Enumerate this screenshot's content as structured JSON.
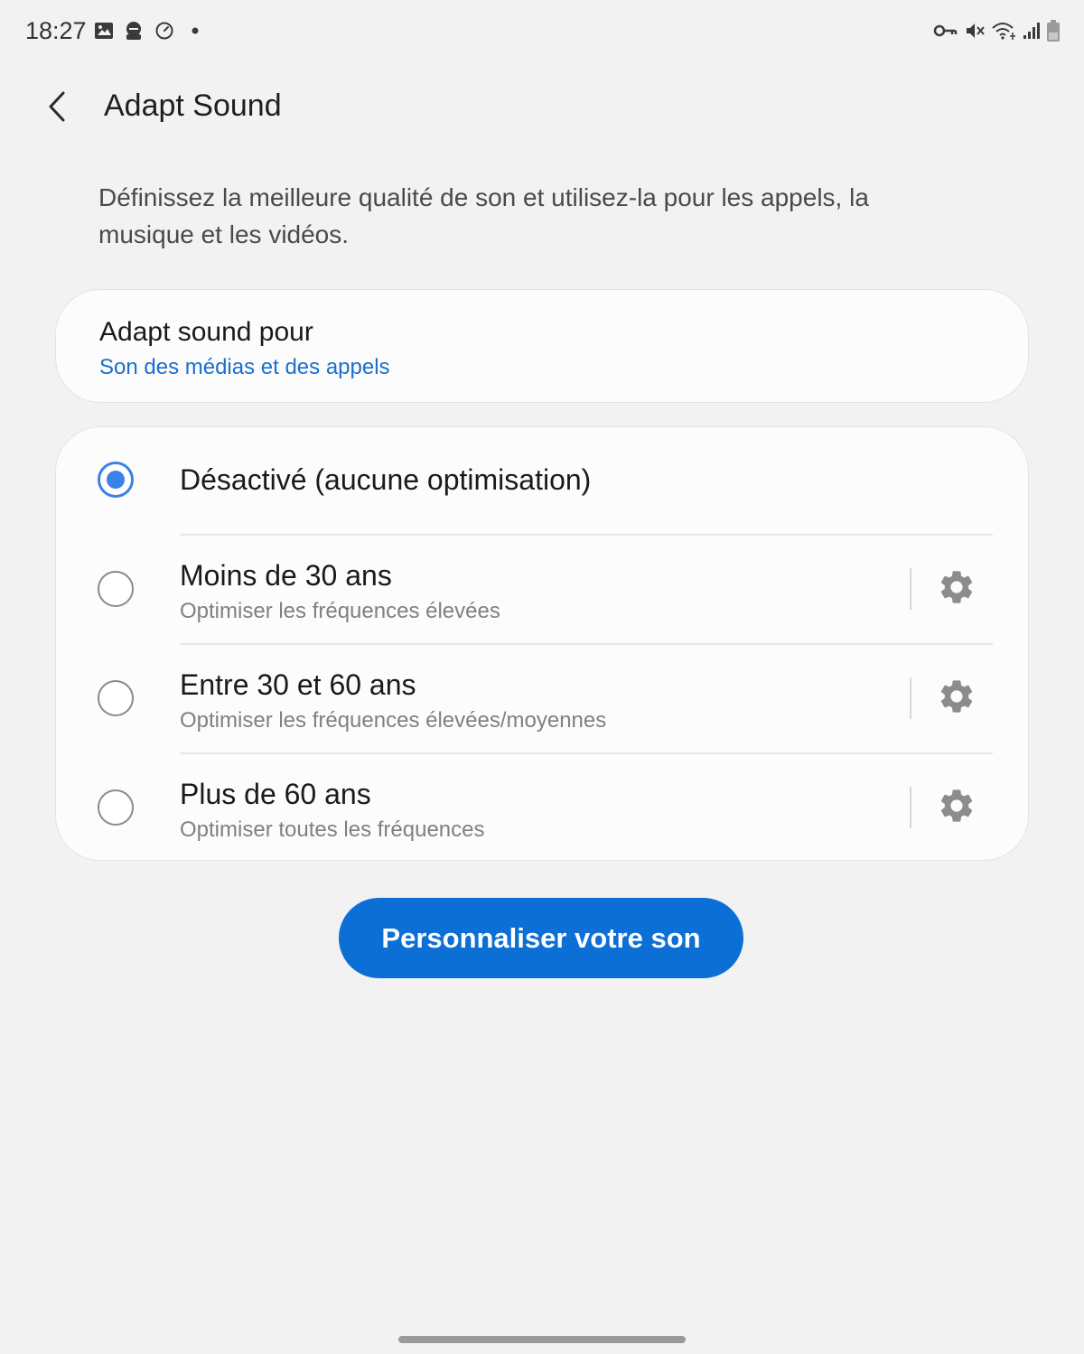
{
  "status_bar": {
    "time": "18:27",
    "left_icons": [
      "image-icon",
      "app-badge-icon",
      "speedometer-icon",
      "dot-icon"
    ],
    "right_icons": [
      "vpn-key-icon",
      "mute-icon",
      "wifi-icon",
      "signal-icon",
      "battery-icon"
    ]
  },
  "header": {
    "back_icon": "chevron-left-icon",
    "title": "Adapt Sound"
  },
  "description": "Définissez la meilleure qualité de son et utilisez-la pour les appels, la musique et les vidéos.",
  "target": {
    "title": "Adapt sound pour",
    "value": "Son des médias et des appels"
  },
  "options": [
    {
      "title": "Désactivé (aucune optimisation)",
      "subtitle": "",
      "selected": true,
      "has_settings": false
    },
    {
      "title": "Moins de 30 ans",
      "subtitle": "Optimiser les fréquences élevées",
      "selected": false,
      "has_settings": true
    },
    {
      "title": "Entre 30 et 60 ans",
      "subtitle": "Optimiser les fréquences élevées/moyennes",
      "selected": false,
      "has_settings": true
    },
    {
      "title": "Plus de 60 ans",
      "subtitle": "Optimiser toutes les fréquences",
      "selected": false,
      "has_settings": true
    }
  ],
  "primary_button": "Personnaliser votre son",
  "colors": {
    "background": "#f2f2f2",
    "card": "#fcfcfc",
    "accent": "#0b6fd6",
    "radio_selected": "#3a82e8",
    "link": "#1a6fcc",
    "gear": "#8c8c8c"
  }
}
